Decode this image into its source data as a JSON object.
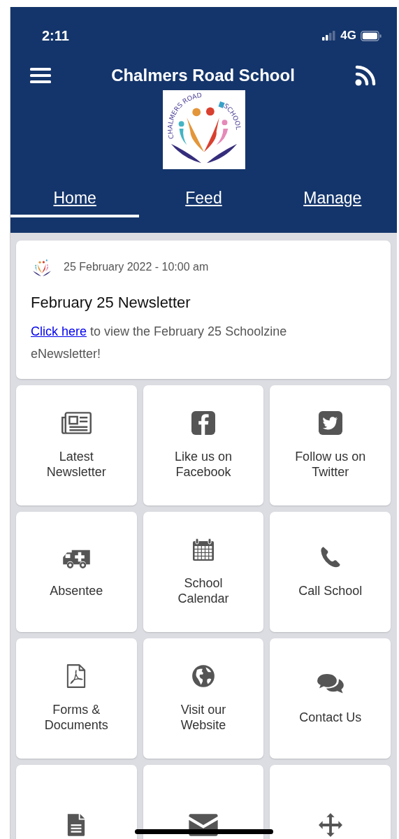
{
  "status_bar": {
    "time": "2:11",
    "network": "4G"
  },
  "header": {
    "title": "Chalmers Road School",
    "logo_text": [
      "CHALMERS ROAD",
      "SCHOOL"
    ]
  },
  "tabs": [
    {
      "label": "Home",
      "selected": true
    },
    {
      "label": "Feed",
      "selected": false
    },
    {
      "label": "Manage",
      "selected": false
    }
  ],
  "post": {
    "date": "25 February 2022 - 10:00 am",
    "title": "February 25 Newsletter",
    "link": "Click here",
    "text": "to view the February 25 Schoolzine eNewsletter!"
  },
  "tiles": [
    {
      "kind": "newspaper",
      "label": "Latest Newsletter"
    },
    {
      "kind": "facebook",
      "label": "Like us on Facebook"
    },
    {
      "kind": "twitter",
      "label": "Follow us on Twitter"
    },
    {
      "kind": "ambulance",
      "label": "Absentee"
    },
    {
      "kind": "calendar",
      "label": "School Calendar"
    },
    {
      "kind": "phone",
      "label": "Call School"
    },
    {
      "kind": "pdf",
      "label": "Forms & Documents"
    },
    {
      "kind": "globe",
      "label": "Visit our Website"
    },
    {
      "kind": "chat",
      "label": "Contact Us"
    },
    {
      "kind": "document"
    },
    {
      "kind": "envelope"
    },
    {
      "kind": "move"
    }
  ]
}
